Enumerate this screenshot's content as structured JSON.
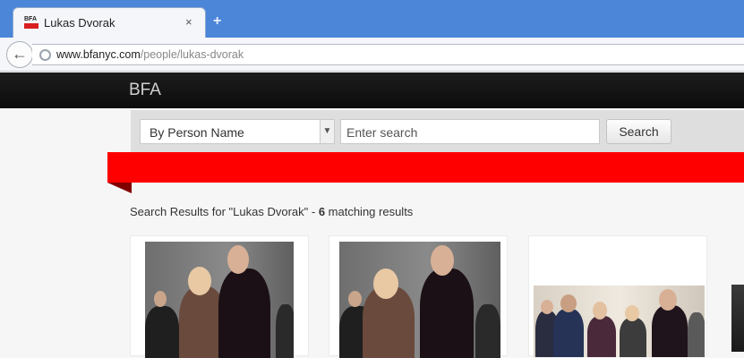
{
  "browser": {
    "tab_title": "Lukas Dvorak",
    "tab_close": "×",
    "new_tab": "+",
    "favicon_text": "BFA",
    "url_host": "www.bfanyc.com",
    "url_path": "/people/lukas-dvorak"
  },
  "site": {
    "brand": "BFA"
  },
  "search": {
    "filter_selected": "By Person Name",
    "input_placeholder": "Enter search",
    "button_label": "Search"
  },
  "results": {
    "prefix": "Search Results for \"Lukas Dvorak\" - ",
    "count": "6",
    "suffix": " matching results"
  },
  "colors": {
    "ribbon": "#ff0000",
    "navbar": "#111111",
    "browser_frame": "#4b86d9"
  },
  "cards": [
    {
      "name": "result-card-1"
    },
    {
      "name": "result-card-2"
    },
    {
      "name": "result-card-3"
    }
  ]
}
